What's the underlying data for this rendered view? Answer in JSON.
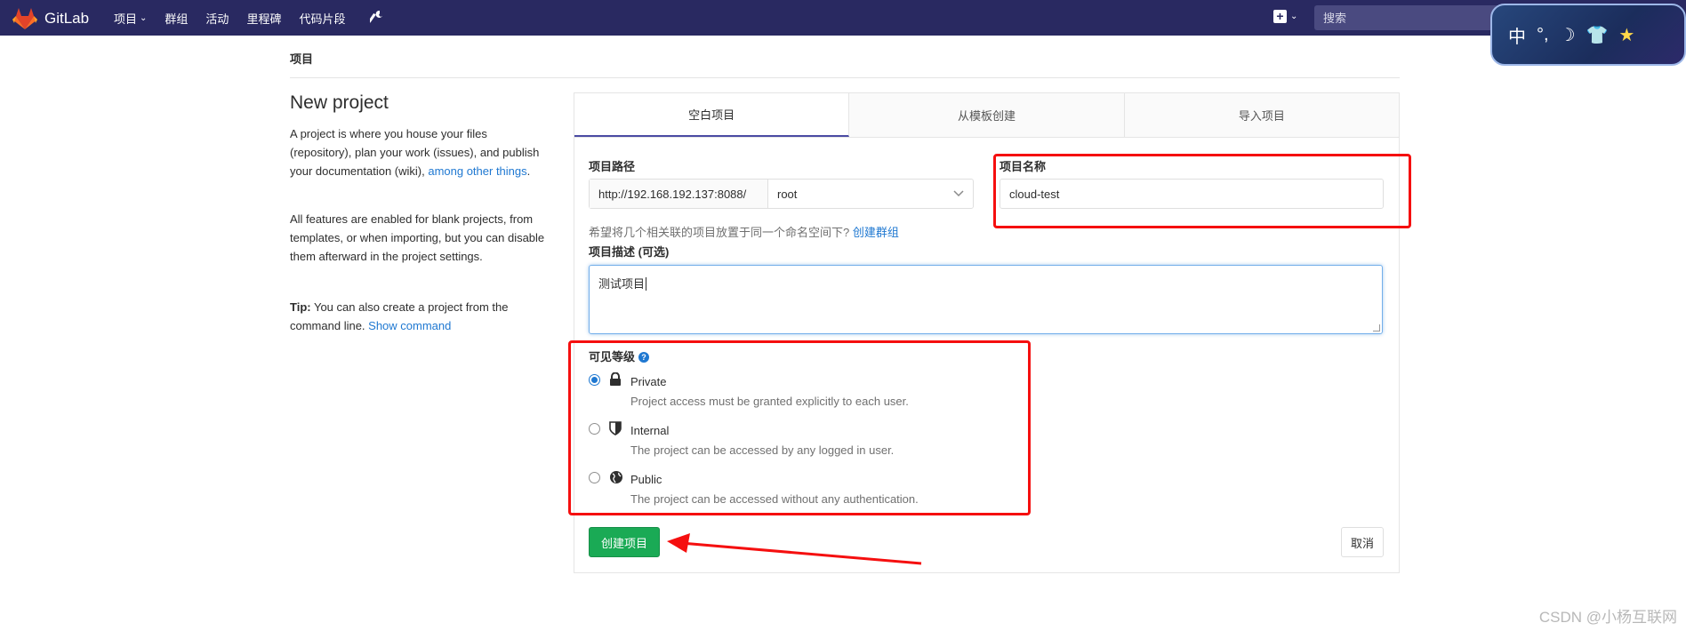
{
  "navbar": {
    "brand": "GitLab",
    "links": [
      {
        "label": "项目",
        "caret": "⌄"
      },
      {
        "label": "群组"
      },
      {
        "label": "活动"
      },
      {
        "label": "里程碑"
      },
      {
        "label": "代码片段"
      }
    ],
    "plus_label": "+",
    "caret": "⌄",
    "search_placeholder": "搜索"
  },
  "ime": {
    "items": [
      "中",
      "°,",
      "☽",
      "👕",
      "★"
    ]
  },
  "breadcrumb": "项目",
  "intro": {
    "title": "New project",
    "para1": "A project is where you house your files (repository), plan your work (issues), and publish your documentation (wiki), ",
    "para1_link": "among other things",
    "para1_end": ".",
    "para2": "All features are enabled for blank projects, from templates, or when importing, but you can disable them afterward in the project settings.",
    "tip_label": "Tip:",
    "tip_text": " You can also create a project from the command line. ",
    "tip_link": "Show command"
  },
  "tabs": [
    {
      "label": "空白项目",
      "active": true
    },
    {
      "label": "从模板创建",
      "active": false
    },
    {
      "label": "导入项目",
      "active": false
    }
  ],
  "form": {
    "path_label": "项目路径",
    "path_prefix": "http://192.168.192.137:8088/",
    "namespace": "root",
    "name_label": "项目名称",
    "name_value": "cloud-test",
    "help_text": "希望将几个相关联的项目放置于同一个命名空间下? ",
    "help_link": "创建群组",
    "desc_label": "项目描述 (可选)",
    "desc_value": "测试项目",
    "visibility_label": "可见等级",
    "visibility_help": "?",
    "visibility": [
      {
        "title": "Private",
        "desc": "Project access must be granted explicitly to each user.",
        "icon": "lock-icon",
        "checked": true
      },
      {
        "title": "Internal",
        "desc": "The project can be accessed by any logged in user.",
        "icon": "shield-icon",
        "checked": false
      },
      {
        "title": "Public",
        "desc": "The project can be accessed without any authentication.",
        "icon": "globe-icon",
        "checked": false
      }
    ],
    "create_button": "创建项目",
    "cancel_button": "取消"
  },
  "colors": {
    "navbar": "#292961",
    "create": "#1aaa55",
    "link": "#1f78d1",
    "annotation": "#f50f0f"
  },
  "watermark": "CSDN @小杨互联网"
}
